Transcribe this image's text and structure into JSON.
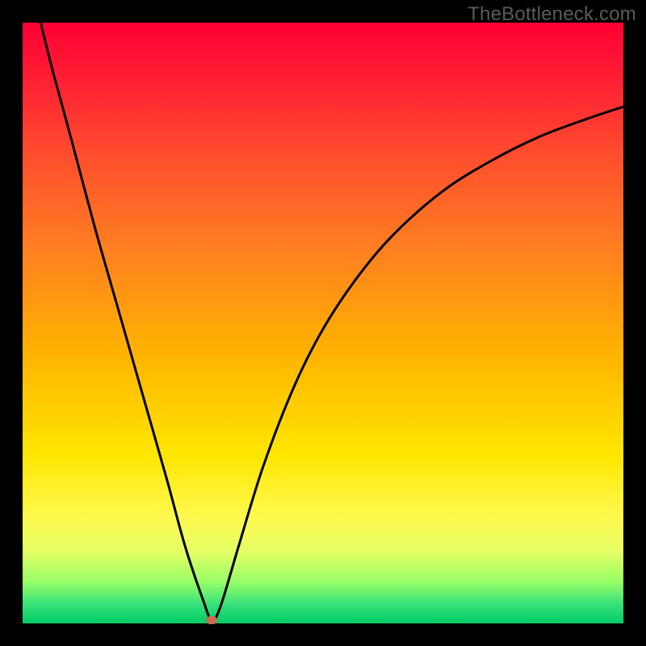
{
  "watermark": "TheBottleneck.com",
  "colors": {
    "page_bg": "#000000",
    "curve": "#000000",
    "marker": "#c96a4f",
    "gradient_stops": [
      "#ff0033",
      "#ff1a33",
      "#ff4d2e",
      "#ff8020",
      "#ffb300",
      "#ffe600",
      "#fff94d",
      "#e6ff66",
      "#99ff66",
      "#33e07a",
      "#00cc66"
    ]
  },
  "chart_data": {
    "type": "line",
    "title": "",
    "xlabel": "",
    "ylabel": "",
    "xlim": [
      0,
      100
    ],
    "ylim": [
      0,
      100
    ],
    "grid": false,
    "series": [
      {
        "name": "bottleneck-curve",
        "x": [
          3,
          5,
          8,
          12,
          16,
          20,
          24,
          27,
          30,
          31.5,
          33,
          36,
          40,
          45,
          50,
          56,
          62,
          70,
          78,
          86,
          94,
          100
        ],
        "values": [
          100,
          92,
          81,
          66,
          52,
          38,
          24,
          13,
          4,
          0.5,
          3,
          13,
          26,
          39,
          49,
          58,
          65,
          72,
          77,
          81,
          84,
          86
        ]
      }
    ],
    "marker": {
      "x": 31.5,
      "y": 0.5
    },
    "notes": "Values estimated from pixel positions; y is percent of plot height (0 at bottom)."
  }
}
